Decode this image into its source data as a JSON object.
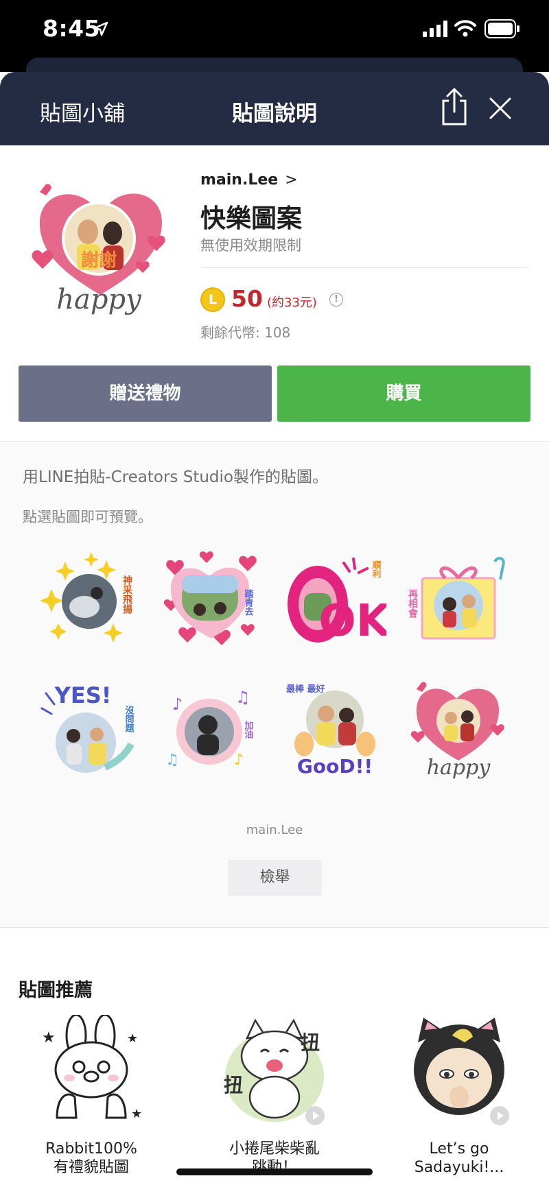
{
  "status_bar": {
    "time": "8:45"
  },
  "header": {
    "store_label": "貼圖小舖",
    "title": "貼圖說明"
  },
  "product": {
    "author": "main.Lee",
    "author_chevron": ">",
    "title": "快樂圖案",
    "validity": "無使用效期限制",
    "coin_letter": "L",
    "price": "50",
    "price_approx": "(約33元)",
    "info_symbol": "!",
    "balance": "剩餘代幣: 108",
    "thumb_caption": "happy",
    "thumb_badge": "謝謝"
  },
  "actions": {
    "gift_label": "贈送禮物",
    "buy_label": "購買"
  },
  "description": {
    "line1": "用LINE拍貼-Creators Studio製作的貼圖。",
    "line2": "點選貼圖即可預覽。"
  },
  "stickers": [
    {
      "name": "sticker-sparkle",
      "caption": "神采飛揚",
      "accent": "#f2c811"
    },
    {
      "name": "sticker-hearts-green",
      "caption": "踏青去",
      "accent": "#e8427a"
    },
    {
      "name": "sticker-ok",
      "caption": "順利",
      "accent": "#e0207a"
    },
    {
      "name": "sticker-gift",
      "caption": "再相會",
      "accent": "#e86aa0"
    },
    {
      "name": "sticker-yes",
      "caption": "沒問題",
      "accent": "#5860d8"
    },
    {
      "name": "sticker-cheer",
      "caption": "加油",
      "accent": "#9a66d8"
    },
    {
      "name": "sticker-good",
      "caption": "最棒 最好",
      "accent": "#5a3fc0"
    },
    {
      "name": "sticker-happy",
      "caption": "happy",
      "accent": "#e85a7a"
    }
  ],
  "sticker_texts": {
    "ok": "OK!",
    "yes": "YES!",
    "good": "GooD!!"
  },
  "footer": {
    "copyright": "main.Lee",
    "report_label": "檢舉"
  },
  "recommendations": {
    "title": "貼圖推薦",
    "items": [
      {
        "name_line1": "Rabbit100%",
        "name_line2": "有禮貌貼圖"
      },
      {
        "name_line1": "小捲尾柴柴亂",
        "name_line2": "跳動！"
      },
      {
        "name_line1": "Let’s go",
        "name_line2": "Sadayuki!..."
      }
    ]
  },
  "colors": {
    "header_bg": "#232c43",
    "gift_button": "#6b7088",
    "buy_button": "#4cb549",
    "price": "#c4262d",
    "coin": "#f4c51b"
  }
}
